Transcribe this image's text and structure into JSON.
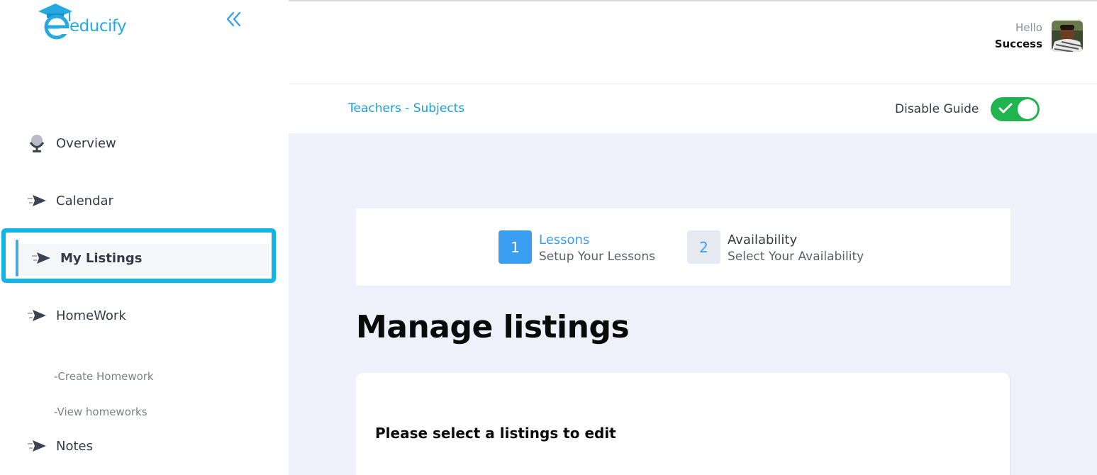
{
  "app": {
    "logo_text": "educify",
    "brand_color": "#26a9e0",
    "accent_color": "#0fb4e8"
  },
  "sidebar": {
    "collapse_icon": "chevrons-left-icon",
    "items": [
      {
        "label": "Overview",
        "icon": "microphone-icon"
      },
      {
        "label": "Calendar",
        "icon": "send-icon"
      },
      {
        "label": "My Listings",
        "icon": "send-icon",
        "active": true
      },
      {
        "label": "HomeWork",
        "icon": "send-icon"
      },
      {
        "label": "Notes",
        "icon": "send-icon"
      }
    ],
    "sub_items": [
      {
        "label": "-Create Homework"
      },
      {
        "label": "-View homeworks"
      }
    ]
  },
  "header": {
    "greeting": "Hello",
    "username": "Success"
  },
  "breadcrumb": {
    "text": "Teachers - Subjects"
  },
  "guide": {
    "label": "Disable Guide",
    "enabled": true,
    "toggle_color": "#1fb44f"
  },
  "stepper": {
    "steps": [
      {
        "number": "1",
        "title": "Lessons",
        "subtitle": "Setup Your Lessons",
        "active": true
      },
      {
        "number": "2",
        "title": "Availability",
        "subtitle": "Select Your Availability",
        "active": false
      }
    ]
  },
  "main": {
    "title": "Manage listings",
    "prompt": "Please select a listings to edit"
  }
}
